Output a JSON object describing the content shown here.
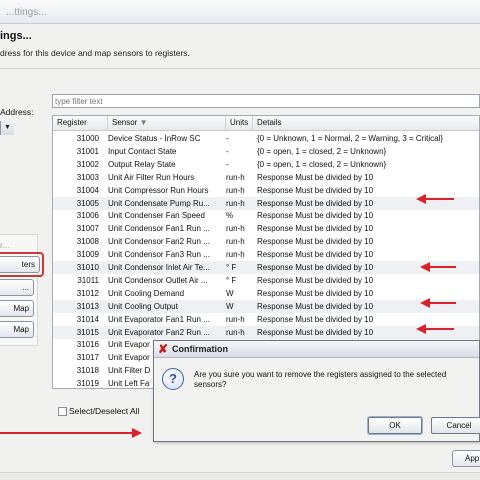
{
  "window": {
    "title": "...ttings..."
  },
  "header": {
    "heading": "ings...",
    "subtitle": "dress for this device and map sensors to registers."
  },
  "left_panel": {
    "address_label": "Address:",
    "group_label": "r...",
    "buttons": [
      "ters",
      "...",
      "Map",
      "Map"
    ]
  },
  "filter": {
    "placeholder": "type filter text"
  },
  "table": {
    "columns": [
      "Register",
      "Sensor",
      "Units",
      "Details"
    ],
    "rows": [
      {
        "register": "31000",
        "sensor": "Device Status - InRow SC",
        "units": "-",
        "details": "{0 = Unknown, 1 = Normal, 2 = Warning, 3 = Critical}"
      },
      {
        "register": "31001",
        "sensor": "Input Contact State",
        "units": "-",
        "details": "{0 = open, 1 = closed, 2 = Unknown}"
      },
      {
        "register": "31002",
        "sensor": "Output Relay State",
        "units": "-",
        "details": "{0 = open, 1 = closed, 2 = Unknown}"
      },
      {
        "register": "31003",
        "sensor": "Unit Air Filter Run Hours",
        "units": "run-h",
        "details": "Response Must be divided by 10"
      },
      {
        "register": "31004",
        "sensor": "Unit Compressor Run Hours",
        "units": "run-h",
        "details": "Response Must be divided by 10"
      },
      {
        "register": "31005",
        "sensor": "Unit Condensate Pump Ru...",
        "units": "run-h",
        "details": "Response Must be divided by 10"
      },
      {
        "register": "31006",
        "sensor": "Unit Condenser Fan Speed",
        "units": "%",
        "details": "Response Must be divided by 10"
      },
      {
        "register": "31007",
        "sensor": "Unit Condensor Fan1 Run ...",
        "units": "run-h",
        "details": "Response Must be divided by 10"
      },
      {
        "register": "31008",
        "sensor": "Unit Condensor Fan2 Run ...",
        "units": "run-h",
        "details": "Response Must be divided by 10"
      },
      {
        "register": "31009",
        "sensor": "Unit Condensor Fan3 Run ...",
        "units": "run-h",
        "details": "Response Must be divided by 10"
      },
      {
        "register": "31010",
        "sensor": "Unit Condensor Inlet Air Te...",
        "units": "° F",
        "details": "Response Must be divided by 10"
      },
      {
        "register": "31011",
        "sensor": "Unit Condensor Outlet Air ...",
        "units": "° F",
        "details": "Response Must be divided by 10"
      },
      {
        "register": "31012",
        "sensor": "Unit Cooling Demand",
        "units": "W",
        "details": "Response Must be divided by 10"
      },
      {
        "register": "31013",
        "sensor": "Unit Cooling Output",
        "units": "W",
        "details": "Response Must be divided by 10"
      },
      {
        "register": "31014",
        "sensor": "Unit Evaporator Fan1 Run ...",
        "units": "run-h",
        "details": "Response Must be divided by 10"
      },
      {
        "register": "31015",
        "sensor": "Unit Evaporator Fan2 Run ...",
        "units": "run-h",
        "details": "Response Must be divided by 10"
      },
      {
        "register": "31016",
        "sensor": "Unit Evapor",
        "units": "",
        "details": ""
      },
      {
        "register": "31017",
        "sensor": "Unit Evapor",
        "units": "",
        "details": ""
      },
      {
        "register": "31018",
        "sensor": "Unit Filter D",
        "units": "",
        "details": ""
      },
      {
        "register": "31019",
        "sensor": "Unit Left Fa",
        "units": "",
        "details": ""
      }
    ]
  },
  "select_all_label": "Select/Deselect All",
  "dialog": {
    "title": "Confirmation",
    "message": "Are you sure you want to remove the registers assigned to the selected sensors?",
    "ok_label": "OK",
    "cancel_label": "Cancel"
  },
  "apply_label": "App",
  "colors": {
    "annotation_red": "#d8232a",
    "selected_row": "#eef0f3"
  }
}
